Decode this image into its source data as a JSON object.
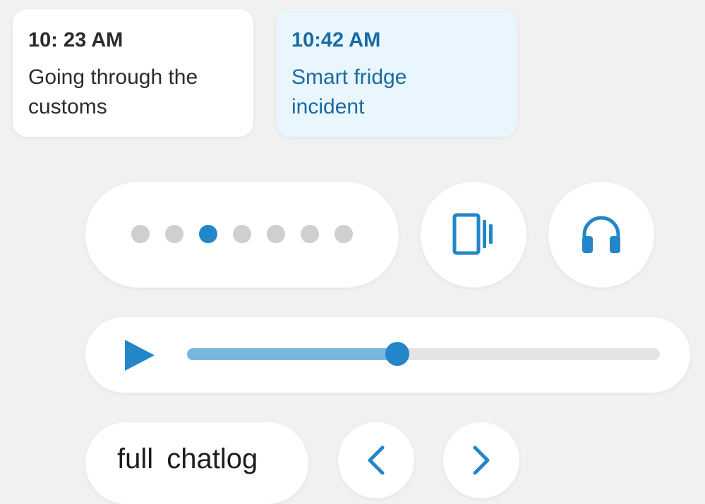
{
  "messages": [
    {
      "time": "10: 23 AM",
      "text": "Going through the customs"
    },
    {
      "time": "10:42 AM",
      "text": "Smart fridge incident"
    }
  ],
  "pager": {
    "total": 7,
    "active_index": 2
  },
  "player": {
    "progress": 0.445
  },
  "chatlog_button": {
    "label": "full chatlog"
  },
  "icons": {
    "transcript": "phone-with-lines-icon",
    "audio": "headphones-icon",
    "play": "play-icon",
    "previous": "chevron-left-icon",
    "next": "chevron-right-icon"
  },
  "colors": {
    "accent": "#2386c8",
    "accent_light": "#76b7e0",
    "selected_card_bg": "#eaf6fd",
    "selected_card_text": "#1a6aa3",
    "dot_inactive": "#cfcfcf"
  }
}
